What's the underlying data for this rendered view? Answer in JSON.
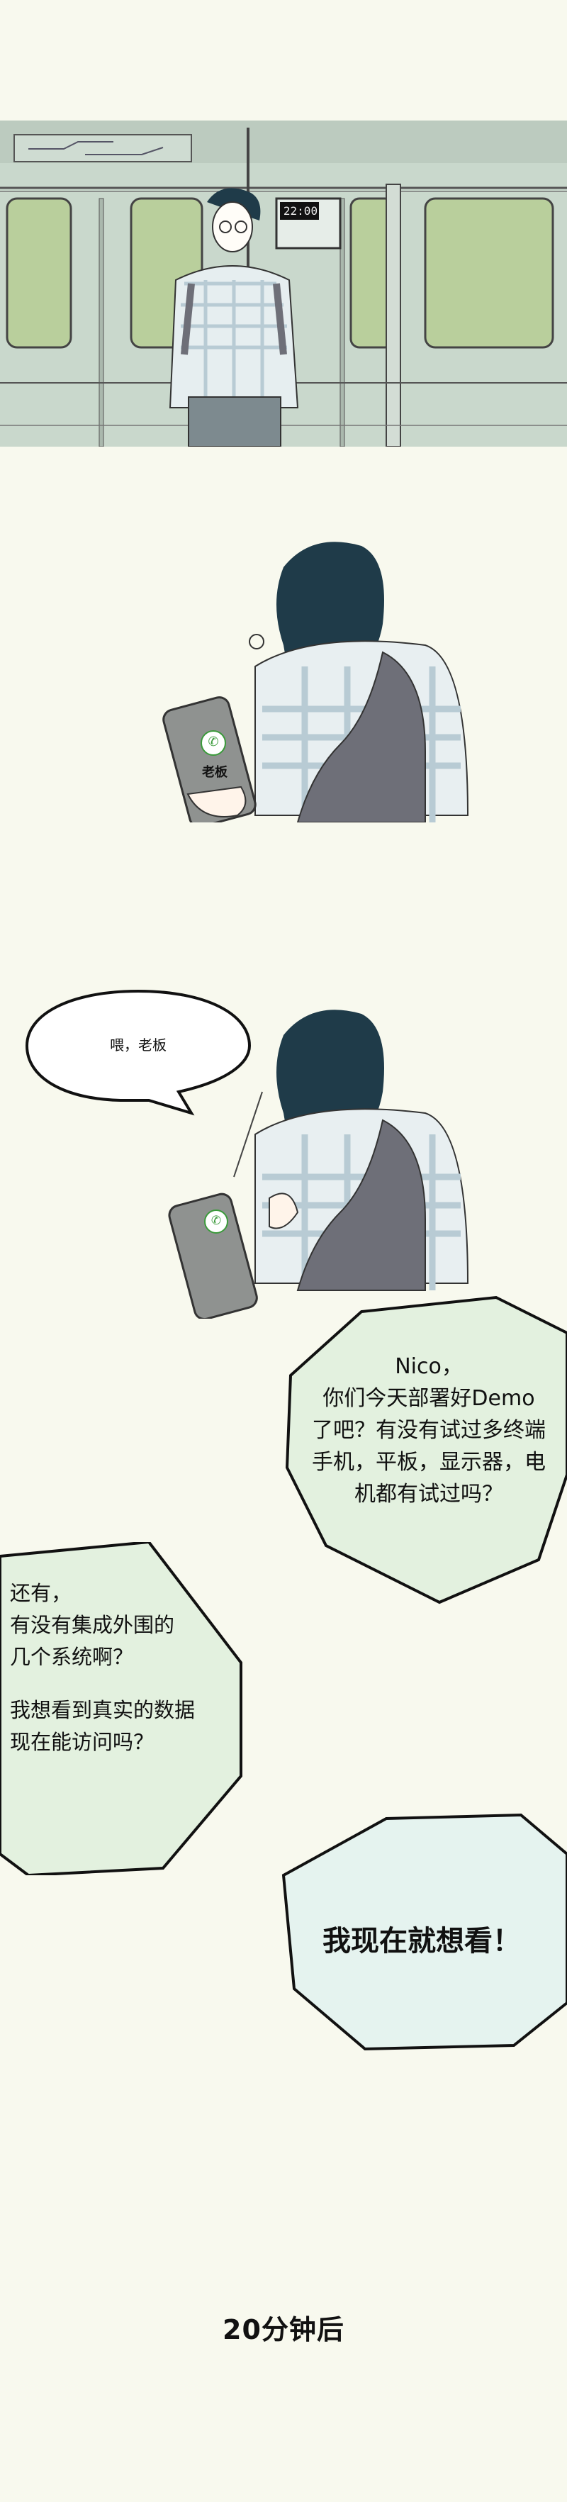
{
  "panel1": {
    "clock_text": "22:00"
  },
  "panel2": {
    "phone_caller": "老板"
  },
  "panel3": {
    "bubble_text": "喂，老板"
  },
  "bubble_boss_1": {
    "lines": [
      "Nico，",
      "你们今天部署好Demo",
      "了吧？有没有试过多终端",
      "手机，平板，显示器，电",
      "机都有试过吗？"
    ]
  },
  "bubble_boss_2": {
    "lines": [
      "还有，",
      "有没有集成外围的",
      "几个系统啊？",
      "",
      "我想看到真实的数据",
      "现在能访问吗？"
    ]
  },
  "bubble_boss_3": {
    "text": "我现在就想看！"
  },
  "caption": {
    "text": "20分钟后"
  },
  "colors": {
    "background": "#f8f9ee",
    "train": "#c9d8cc",
    "window": "#b9cf9c",
    "hair": "#1f3b49",
    "shirt_check": "#b8cbd4",
    "bag": "#6e6f78",
    "bubble_green": "#e3f1df",
    "bubble_blue": "#e5f3ef",
    "phone_green": "#3a9a3a"
  },
  "icons": [
    "phone-call-icon"
  ]
}
